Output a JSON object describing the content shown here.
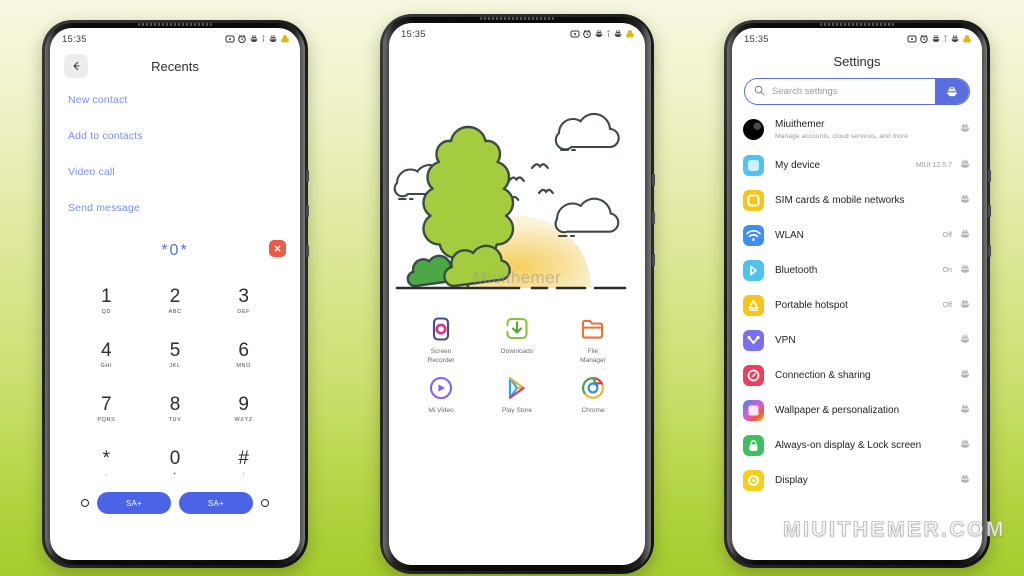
{
  "background": {
    "top_color": "#f8f7e2",
    "bottom_color": "#a5cc2e"
  },
  "watermark": {
    "text": "MIUITHEMER.COM"
  },
  "phones": {
    "left": {
      "status": {
        "time": "15:35"
      },
      "header": {
        "title": "Recents",
        "back_icon": "back-arrow-icon"
      },
      "links": [
        {
          "label": "New contact"
        },
        {
          "label": "Add to contacts"
        },
        {
          "label": "Video call"
        },
        {
          "label": "Send message"
        }
      ],
      "dialer": {
        "number": "*0*",
        "clear_icon": "close-icon",
        "keys": [
          {
            "digit": "1",
            "sub": "QD"
          },
          {
            "digit": "2",
            "sub": "ABC"
          },
          {
            "digit": "3",
            "sub": "DEF"
          },
          {
            "digit": "4",
            "sub": "GHI"
          },
          {
            "digit": "5",
            "sub": "JKL"
          },
          {
            "digit": "6",
            "sub": "MNO"
          },
          {
            "digit": "7",
            "sub": "PQRS"
          },
          {
            "digit": "8",
            "sub": "TUV"
          },
          {
            "digit": "9",
            "sub": "WXYZ"
          },
          {
            "digit": "*",
            "sub": ","
          },
          {
            "digit": "0",
            "sub": "+"
          },
          {
            "digit": "#",
            "sub": ";"
          }
        ],
        "call_buttons": [
          {
            "label": "SA+"
          },
          {
            "label": "SA+"
          }
        ],
        "accent_color": "#4a63e7",
        "clear_color": "#ea5c46"
      }
    },
    "middle": {
      "status": {
        "time": "15:35"
      },
      "wallpaper": {
        "watermark_text": "Miuithemer",
        "scene": "tree-sun-clouds-birds"
      },
      "app_rows": [
        [
          {
            "label": "Screen\nRecorder",
            "label_line1": "Screen",
            "label_line2": "Recorder",
            "icon": "screen-recorder-icon"
          },
          {
            "label": "Downloads",
            "label_line1": "Downloads",
            "label_line2": "",
            "icon": "downloads-icon"
          },
          {
            "label": "File Manager",
            "label_line1": "File",
            "label_line2": "Manager",
            "icon": "file-manager-icon"
          }
        ],
        [
          {
            "label": "Mi Video",
            "label_line1": "Mi Video",
            "label_line2": "",
            "icon": "mi-video-icon"
          },
          {
            "label": "Play Store",
            "label_line1": "Play Store",
            "label_line2": "",
            "icon": "play-store-icon"
          },
          {
            "label": "Chrome",
            "label_line1": "Chrome",
            "label_line2": "",
            "icon": "chrome-icon"
          }
        ]
      ]
    },
    "right": {
      "status": {
        "time": "15:35"
      },
      "title": "Settings",
      "search": {
        "placeholder": "Search settings",
        "search_icon": "search-icon",
        "voice_icon": "voice-search-icon",
        "accent_color": "#5a6fe0"
      },
      "items": [
        {
          "label": "Miuithemer",
          "sub": "Manage accounts, cloud services, and more",
          "value": "",
          "icon": "account-avatar",
          "color": "#000000"
        },
        {
          "label": "My device",
          "sub": "",
          "value": "MIUI 12.5.7",
          "icon": "device-icon",
          "color": "#4ec3f0"
        },
        {
          "label": "SIM cards & mobile networks",
          "sub": "",
          "value": "",
          "icon": "sim-icon",
          "color": "#f5c518"
        },
        {
          "label": "WLAN",
          "sub": "",
          "value": "Off",
          "icon": "wifi-icon",
          "color": "#3d8ef0"
        },
        {
          "label": "Bluetooth",
          "sub": "",
          "value": "On",
          "icon": "bluetooth-icon",
          "color": "#4ec3f0"
        },
        {
          "label": "Portable hotspot",
          "sub": "",
          "value": "Off",
          "icon": "hotspot-icon",
          "color": "#f5c518"
        },
        {
          "label": "VPN",
          "sub": "",
          "value": "",
          "icon": "vpn-icon",
          "color": "#7b6ef0"
        },
        {
          "label": "Connection & sharing",
          "sub": "",
          "value": "",
          "icon": "connection-sharing-icon",
          "color": "#ef3e5c"
        },
        {
          "label": "Wallpaper & personalization",
          "sub": "",
          "value": "",
          "icon": "wallpaper-icon",
          "color": "#d45be0"
        },
        {
          "label": "Always-on display & Lock screen",
          "sub": "",
          "value": "",
          "icon": "lock-icon",
          "color": "#3fc060"
        },
        {
          "label": "Display",
          "sub": "",
          "value": "",
          "icon": "display-icon",
          "color": "#f5d018"
        }
      ]
    }
  }
}
